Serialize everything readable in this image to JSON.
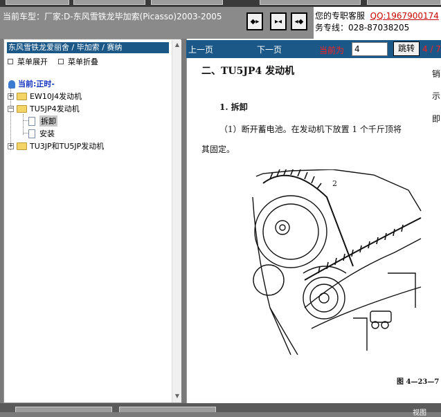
{
  "header": {
    "car_label": "当前车型：厂家:D-东风雪铁龙毕加索(Picasso)2003-2005",
    "nav_buttons": [
      "first-icon",
      "split-icon",
      "last-icon"
    ],
    "service_text": "您的专职客服",
    "qq": "QQ:1967900174",
    "service_line2": "务专线：028-87038205"
  },
  "sidebar": {
    "breadcrumb": "东风雪铁龙爱丽舍 / 毕加索 / 赛纳",
    "expand_label": "菜单展开",
    "collapse_label": "菜单折叠",
    "current_label": "当前:正时-",
    "tree": [
      {
        "label": "EW10J4发动机",
        "expanded": false
      },
      {
        "label": "TU5JP4发动机",
        "expanded": true,
        "children": [
          {
            "label": "拆卸",
            "selected": true
          },
          {
            "label": "安装",
            "selected": false
          }
        ]
      },
      {
        "label": "TU3JP和TU5JP发动机",
        "expanded": false
      }
    ]
  },
  "toolbar": {
    "prev_label": "上一页",
    "next_label": "下一页",
    "current_page_label": "当前为",
    "page_value": "4",
    "jump_label": "跳转",
    "page_total": "4 / 7"
  },
  "document": {
    "heading": "二、TU5JP4 发动机",
    "subheading": "1. 拆卸",
    "para1": "（1）断开蓄电池。在发动机下放置 1 个千斤顶将",
    "para2": "其固定。",
    "side_chars": [
      "销",
      "示",
      "即"
    ],
    "figure_label": "2",
    "figure_caption": "图 4—23—7"
  },
  "footer": {
    "right_text": "视图"
  }
}
